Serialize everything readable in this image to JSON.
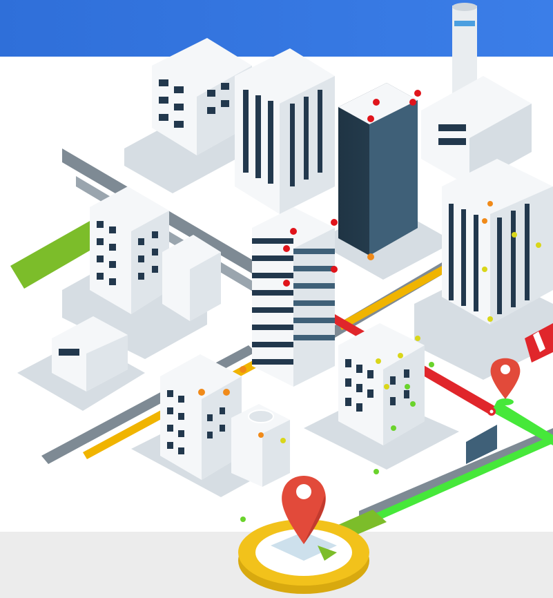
{
  "scene": {
    "kind": "isometric-smart-city-illustration",
    "colors": {
      "banner": "#3b7ee8",
      "ground": "#ececec",
      "building_white": "#f5f7f9",
      "building_shadow": "#d6dde3",
      "window_dark": "#22384d",
      "tower_dark": "#1f3444",
      "tower_side": "#3f6078",
      "road": "#7e8a94",
      "route_red": "#e0262b",
      "route_green": "#46e83a",
      "lane_yellow": "#f0b400",
      "grass": "#7cbd2a",
      "pin_red": "#e24a3a",
      "compass_gold": "#f2c21b",
      "iot_red": "#e0141b",
      "iot_orange": "#f08a19",
      "iot_yellow": "#d9d61a",
      "iot_green": "#6ad32c"
    },
    "icons": [
      "location-pin-icon",
      "location-pin-icon",
      "helipad-icon",
      "compass-map-icon"
    ]
  }
}
